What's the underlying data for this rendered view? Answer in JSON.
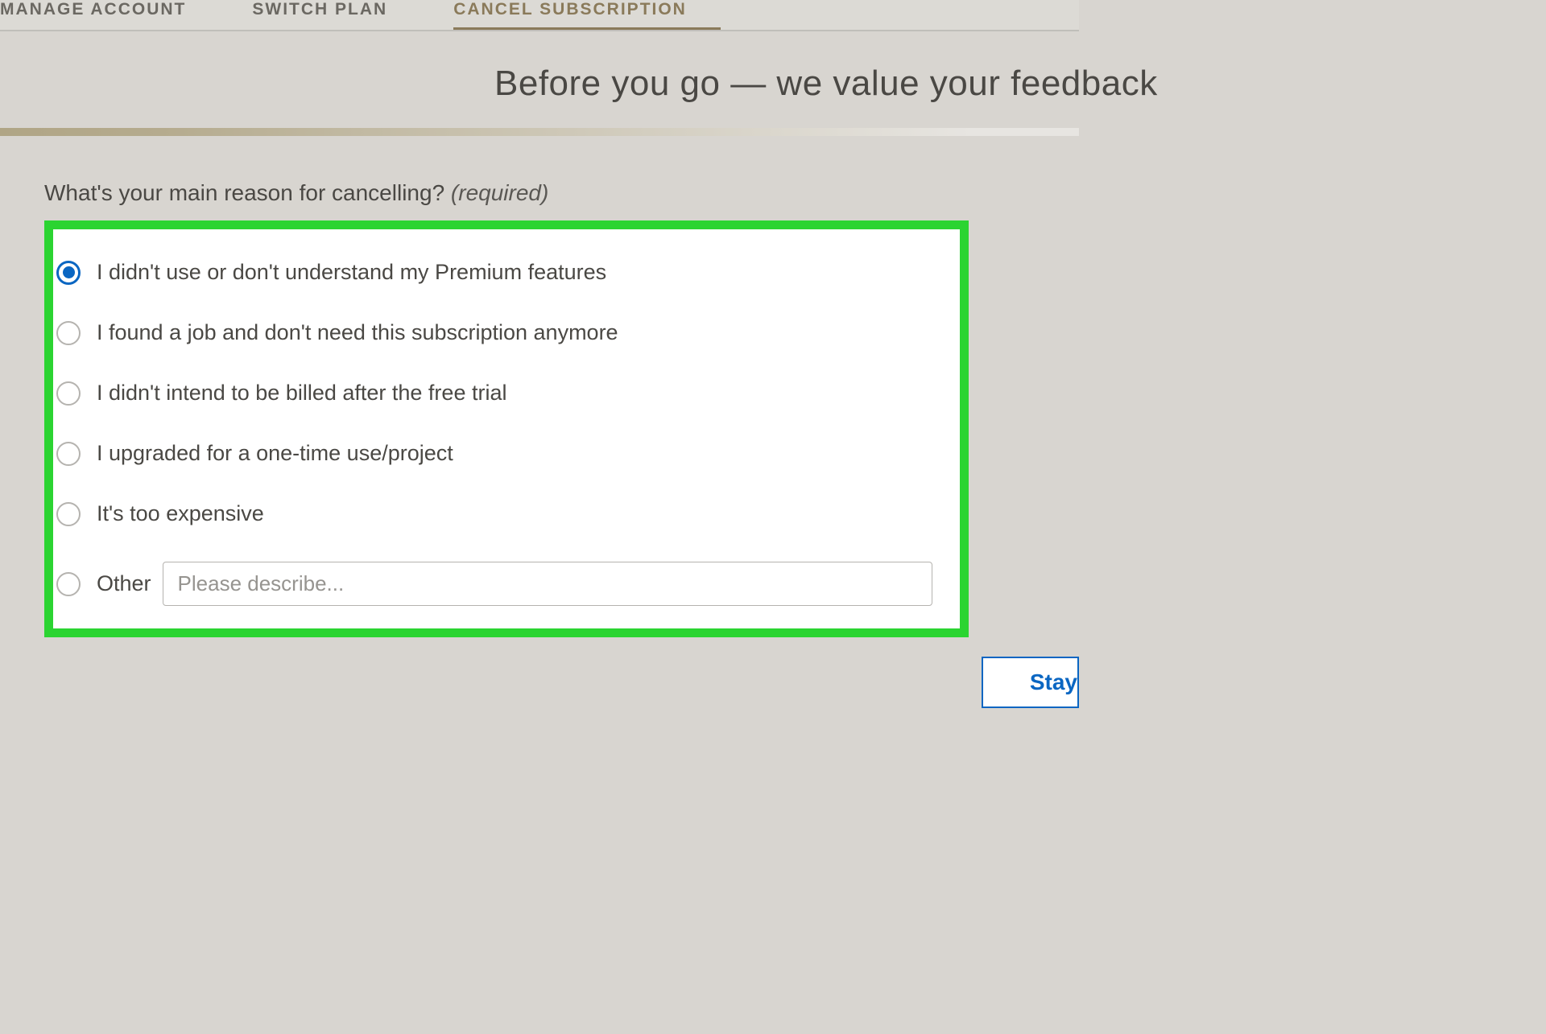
{
  "tabs": {
    "manage": "MANAGE ACCOUNT",
    "switch": "SWITCH PLAN",
    "cancel": "CANCEL SUBSCRIPTION"
  },
  "heading": "Before you go — we value your feedback",
  "question": {
    "text": "What's your main reason for cancelling? ",
    "required": "(required)"
  },
  "options": {
    "opt1": "I didn't use or don't understand my Premium features",
    "opt2": "I found a job and don't need this subscription anymore",
    "opt3": "I didn't intend to be billed after the free trial",
    "opt4": "I upgraded for a one-time use/project",
    "opt5": "It's too expensive",
    "opt6": "Other",
    "other_placeholder": "Please describe..."
  },
  "stay_button": "Stay"
}
